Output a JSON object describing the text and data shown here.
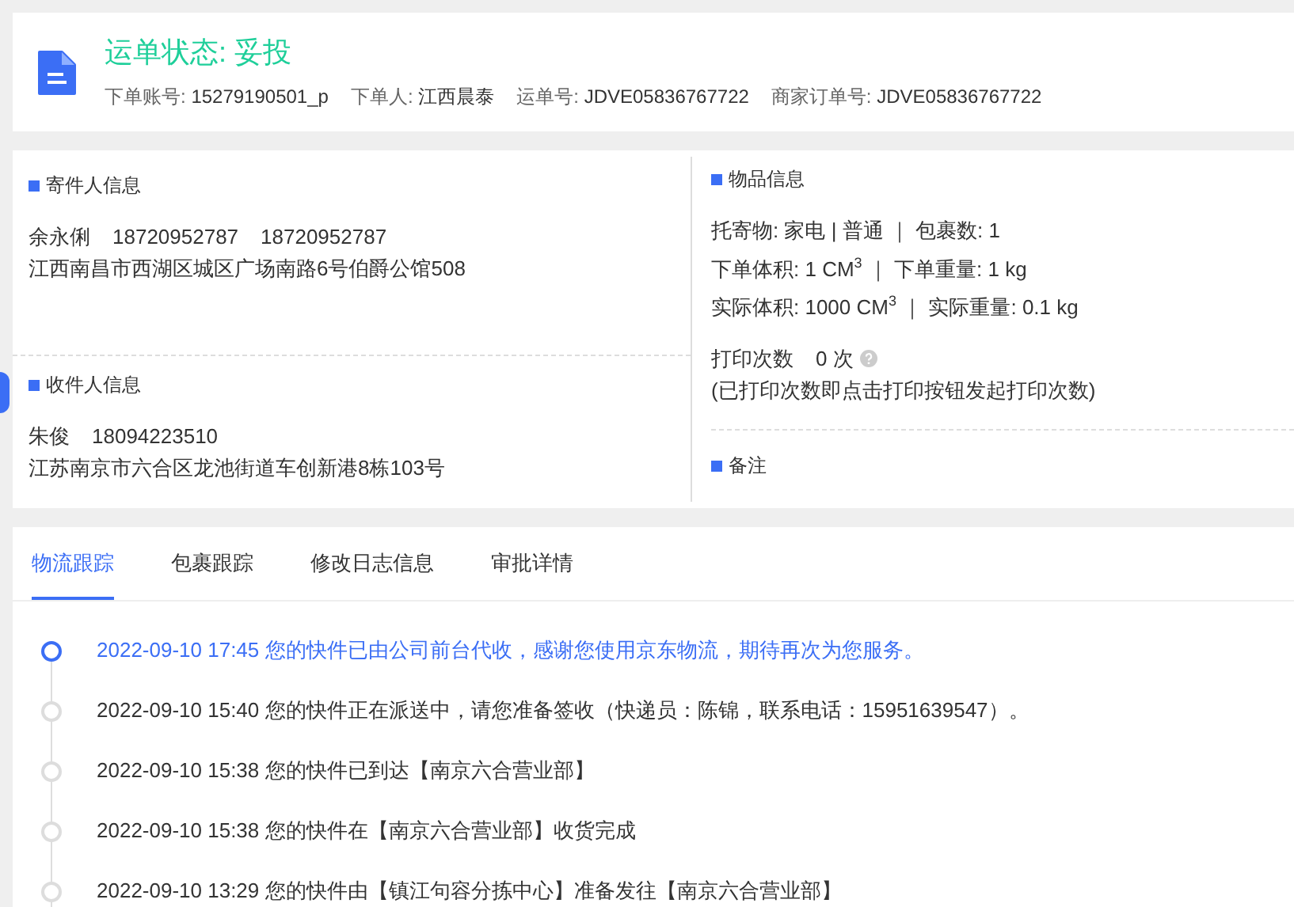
{
  "header": {
    "status_label": "运单状态:",
    "status_value": "妥投",
    "meta": [
      {
        "label": "下单账号:",
        "value": "15279190501_p"
      },
      {
        "label": "下单人:",
        "value": "江西晨泰"
      },
      {
        "label": "运单号:",
        "value": "JDVE05836767722"
      },
      {
        "label": "商家订单号:",
        "value": "JDVE05836767722"
      }
    ]
  },
  "sender": {
    "title": "寄件人信息",
    "name": "余永俐",
    "phones": [
      "18720952787",
      "18720952787"
    ],
    "address": "江西南昌市西湖区城区广场南路6号伯爵公馆508"
  },
  "receiver": {
    "title": "收件人信息",
    "name": "朱俊",
    "phones": [
      "18094223510"
    ],
    "address": "江苏南京市六合区龙池街道车创新港8栋103号"
  },
  "goods": {
    "title": "物品信息",
    "lines": [
      "托寄物:  家电 | 普通 ｜ 包裹数:  1",
      "下单体积:   1 CM$^{3}$ ｜ 下单重量:  1 kg",
      "实际体积:   1000 CM$^{3}$ ｜ 实际重量:  0.1 kg"
    ],
    "print_label": "打印次数",
    "print_count": "0 次",
    "print_note": "(已打印次数即点击打印按钮发起打印次数)"
  },
  "remarks": {
    "title": "备注"
  },
  "tabs": [
    {
      "label": "物流跟踪",
      "selected": true
    },
    {
      "label": "包裹跟踪",
      "selected": false
    },
    {
      "label": "修改日志信息",
      "selected": false
    },
    {
      "label": "审批详情",
      "selected": false
    }
  ],
  "timeline": [
    {
      "text": "2022-09-10 17:45 您的快件已由公司前台代收，感谢您使用京东物流，期待再次为您服务。",
      "selected": true
    },
    {
      "text": "2022-09-10 15:40 您的快件正在派送中，请您准备签收（快递员：陈锦，联系电话：15951639547）。",
      "selected": false
    },
    {
      "text": "2022-09-10 15:38 您的快件已到达【南京六合营业部】",
      "selected": false
    },
    {
      "text": "2022-09-10 15:38 您的快件在【南京六合营业部】收货完成",
      "selected": false
    },
    {
      "text": "2022-09-10 13:29 您的快件由【镇江句容分拣中心】准备发往【南京六合营业部】",
      "selected": false
    }
  ]
}
